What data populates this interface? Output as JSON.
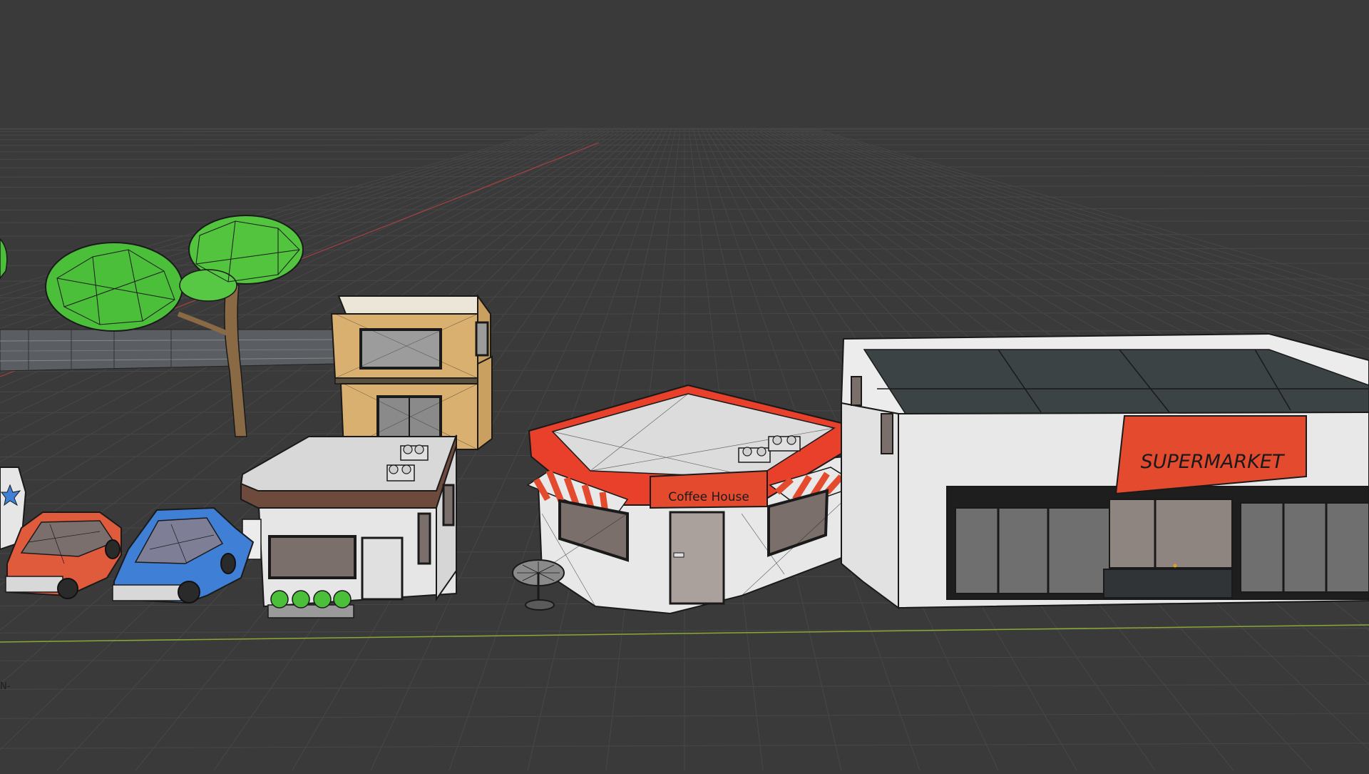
{
  "viewport": {
    "background": "#3a3a3a",
    "grid_color": "#464646",
    "x_axis_color": "#b34545",
    "y_axis_color": "#8aa833"
  },
  "signs": {
    "coffee_house": "Coffee House",
    "supermarket": "SUPERMARKET"
  },
  "colors": {
    "tree_foliage": "#4cbf3a",
    "tree_trunk": "#8a6a45",
    "container_tan": "#d9b070",
    "coffee_red": "#e8402a",
    "supermarket_red": "#e34a2e",
    "car_red": "#e05a3c",
    "car_blue": "#3f7fd6",
    "wall_white": "#e6e6e6",
    "roof_dark": "#3b4345",
    "window_gray": "#8a8a8a"
  }
}
